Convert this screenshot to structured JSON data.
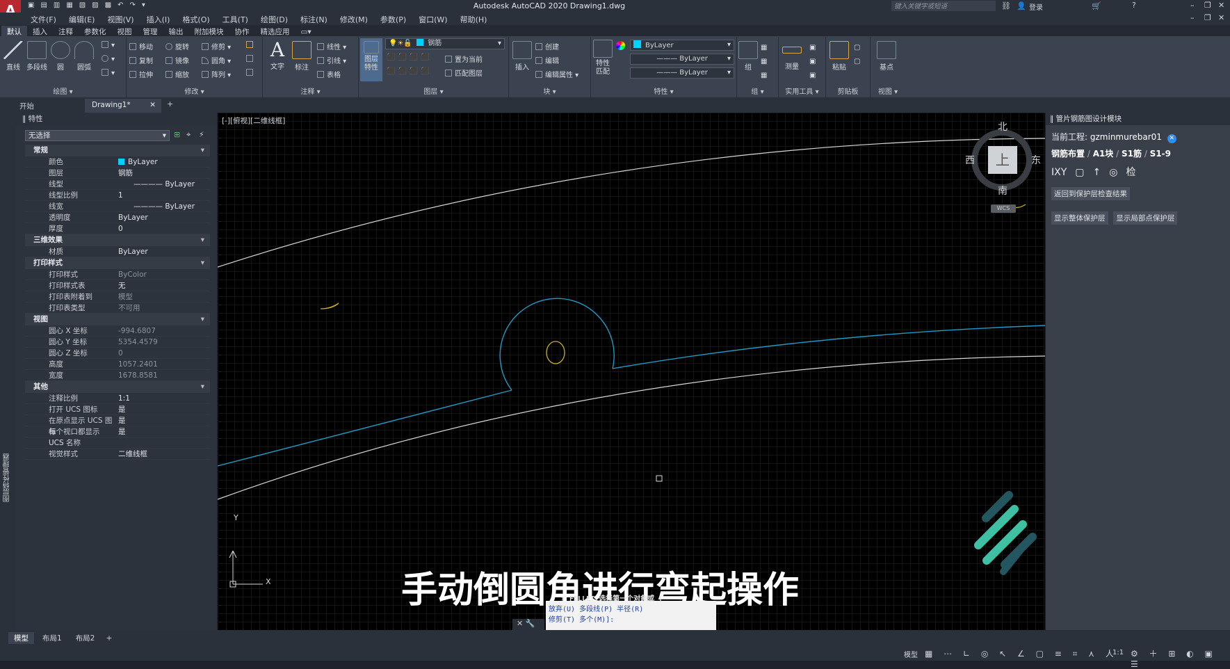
{
  "app": {
    "title": "Autodesk AutoCAD 2020    Drawing1.dwg",
    "search_placeholder": "键入关键字或短语",
    "login": "登录"
  },
  "menu": [
    "文件(F)",
    "编辑(E)",
    "视图(V)",
    "插入(I)",
    "格式(O)",
    "工具(T)",
    "绘图(D)",
    "标注(N)",
    "修改(M)",
    "参数(P)",
    "窗口(W)",
    "帮助(H)"
  ],
  "ribbon_tabs": [
    "默认",
    "插入",
    "注释",
    "参数化",
    "视图",
    "管理",
    "输出",
    "附加模块",
    "协作",
    "精选应用"
  ],
  "ribbon": {
    "draw": {
      "label": "绘图",
      "line": "直线",
      "polyline": "多段线",
      "circle": "圆",
      "arc": "圆弧"
    },
    "modify": {
      "label": "修改",
      "move": "移动",
      "rotate": "旋转",
      "trim": "修剪",
      "copy": "复制",
      "mirror": "镜像",
      "fillet": "圆角",
      "stretch": "拉伸",
      "scale": "缩放",
      "array": "阵列"
    },
    "annotation": {
      "label": "注释",
      "text": "文字",
      "dim": "标注",
      "linear": "线性",
      "leader": "引线",
      "table": "表格"
    },
    "layers": {
      "label": "图层",
      "props": "图层\n特性",
      "current": "钢筋",
      "set_current": "置为当前",
      "match": "匹配图层"
    },
    "block": {
      "label": "块",
      "insert": "插入",
      "create": "创建",
      "edit": "编辑",
      "edit_attr": "编辑属性"
    },
    "properties": {
      "label": "特性",
      "match": "特性\n匹配",
      "color": "ByLayer",
      "linetype": "ByLayer",
      "lineweight": "ByLayer"
    },
    "groups": {
      "label": "组",
      "group": "组"
    },
    "utilities": {
      "label": "实用工具",
      "measure": "测量"
    },
    "clipboard": {
      "label": "剪贴板",
      "paste": "粘贴"
    },
    "view": {
      "label": "视图",
      "base": "基点"
    }
  },
  "doc_tabs": {
    "start": "开始",
    "drawing": "Drawing1*"
  },
  "properties_panel": {
    "title": "特性",
    "selection": "无选择",
    "sections": [
      {
        "name": "常规",
        "rows": [
          [
            "颜色",
            "ByLayer"
          ],
          [
            "图层",
            "钢筋"
          ],
          [
            "线型",
            "ByLayer"
          ],
          [
            "线型比例",
            "1"
          ],
          [
            "线宽",
            "ByLayer"
          ],
          [
            "透明度",
            "ByLayer"
          ],
          [
            "厚度",
            "0"
          ]
        ]
      },
      {
        "name": "三维效果",
        "rows": [
          [
            "材质",
            "ByLayer"
          ]
        ]
      },
      {
        "name": "打印样式",
        "rows": [
          [
            "打印样式",
            "ByColor"
          ],
          [
            "打印样式表",
            "无"
          ],
          [
            "打印表附着到",
            "模型"
          ],
          [
            "打印表类型",
            "不可用"
          ]
        ]
      },
      {
        "name": "视图",
        "rows": [
          [
            "圆心 X 坐标",
            "-994.6807"
          ],
          [
            "圆心 Y 坐标",
            "5354.4579"
          ],
          [
            "圆心 Z 坐标",
            "0"
          ],
          [
            "高度",
            "1057.2401"
          ],
          [
            "宽度",
            "1678.8581"
          ]
        ]
      },
      {
        "name": "其他",
        "rows": [
          [
            "注释比例",
            "1:1"
          ],
          [
            "打开 UCS 图标",
            "是"
          ],
          [
            "在原点显示 UCS 图标",
            "是"
          ],
          [
            "每个视口都显示 UCS",
            "是"
          ],
          [
            "UCS 名称",
            ""
          ],
          [
            "视觉样式",
            "二维线框"
          ]
        ]
      }
    ],
    "side_label": "图层特性管理器"
  },
  "viewport": {
    "label": "[-][俯视][二维线框]",
    "viewcube": {
      "north": "北",
      "south": "南",
      "east": "东",
      "west": "西",
      "top": "上",
      "wcs": "WCS"
    },
    "ucs_x": "X",
    "ucs_y": "Y"
  },
  "subtitle": "手动倒圆角进行弯起操作",
  "command": {
    "line1": "✕ FILLET 选择第一个对象或 [",
    "line2": "放弃(U) 多段线(P) 半径(R)",
    "line3": "修剪(T) 多个(M)]:"
  },
  "right_panel": {
    "title": "管片钢筋图设计模块",
    "project_label": "当前工程:",
    "project_name": "gzminmurebar01",
    "breadcrumb": [
      "钢筋布置",
      "A1块",
      "S1筋",
      "S1-9"
    ],
    "tools": [
      "IXY",
      "▢",
      "↑",
      "◎",
      "检"
    ],
    "btn_back": "返回到保护层检查结果",
    "btn_whole": "显示整体保护层",
    "btn_local": "显示局部点保护层"
  },
  "layout_tabs": [
    "模型",
    "布局1",
    "布局2"
  ],
  "status": {
    "model": "模型",
    "scale": "1:1"
  },
  "colors": {
    "cyan": "#1e90b8",
    "white": "#d8d8d8",
    "yellow": "#c8b020",
    "accent": "#00c8ff"
  }
}
